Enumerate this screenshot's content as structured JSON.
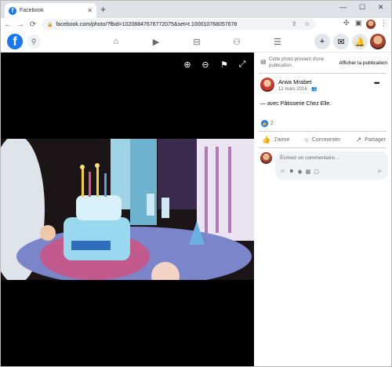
{
  "browser": {
    "tab_title": "Facebook",
    "tab_close": "✕",
    "new_tab": "+",
    "minimize": "—",
    "restore": "☐",
    "close": "✕",
    "url": "facebook.com/photo/?fbid=10208847676772075&set=t.100010768057678"
  },
  "colors": {
    "brand": "#1877f2",
    "photo_bg": "#000000",
    "panel_bg": "#ffffff"
  },
  "photo_viewer": {
    "icons": [
      "zoom-in-icon",
      "zoom-out-icon",
      "tag-icon",
      "fullscreen-icon"
    ]
  },
  "panel": {
    "info_text": "Cette photo provient d'une publication.",
    "info_link": "Afficher la publication",
    "author": "Arwa Mrabet",
    "date": "12 mars 2016 · ",
    "post_text": "— avec Pâtisserie Chez Elle.",
    "like_count": "2",
    "actions": {
      "like": "J'aime",
      "comment": "Commenter",
      "share": "Partager"
    },
    "comment_placeholder": "Écrivez un commentaire…"
  }
}
